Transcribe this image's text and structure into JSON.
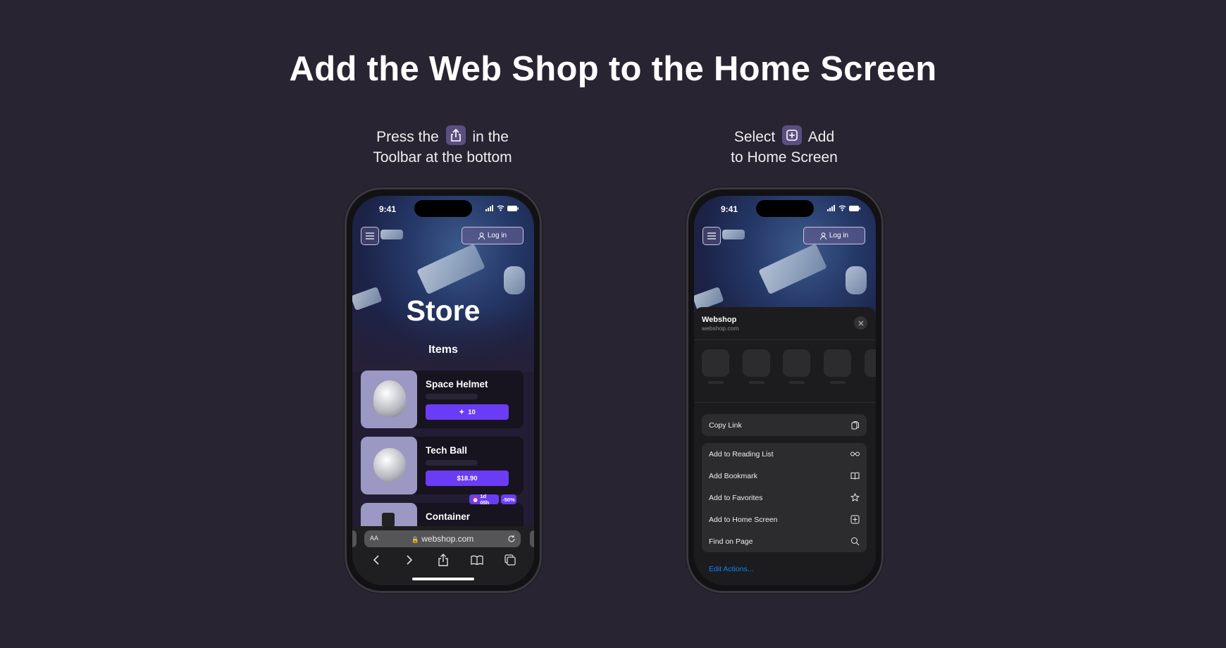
{
  "title": "Add the Web Shop to the Home Screen",
  "steps": [
    {
      "line1_before": "Press the",
      "icon": "share-icon",
      "line1_after": "in the",
      "line2": "Toolbar at the bottom"
    },
    {
      "line1_before": "Select",
      "icon": "add-square-icon",
      "line1_after": "Add",
      "line2": "to Home Screen"
    }
  ],
  "status": {
    "time": "9:41"
  },
  "store": {
    "login_label": "Log in",
    "heading": "Store",
    "section": "Items",
    "items": [
      {
        "name": "Space Helmet",
        "price": "10",
        "price_icon": "sparkle-icon"
      },
      {
        "name": "Tech Ball",
        "price": "$18.90"
      },
      {
        "name": "Container",
        "timer": "1d 05h",
        "discount": "-50%"
      }
    ]
  },
  "safari": {
    "text_size": "AA",
    "url": "webshop.com"
  },
  "share_sheet": {
    "title": "Webshop",
    "url": "webshop.com",
    "copy_link": "Copy Link",
    "actions": [
      {
        "label": "Add to Reading List",
        "icon": "glasses-icon"
      },
      {
        "label": "Add Bookmark",
        "icon": "book-icon"
      },
      {
        "label": "Add to Favorites",
        "icon": "star-icon"
      },
      {
        "label": "Add to Home Screen",
        "icon": "add-square-icon"
      },
      {
        "label": "Find on Page",
        "icon": "search-icon"
      }
    ],
    "edit_actions": "Edit Actions..."
  },
  "colors": {
    "background": "#282431",
    "accent": "#6b3cf5",
    "link": "#0a84ff"
  }
}
